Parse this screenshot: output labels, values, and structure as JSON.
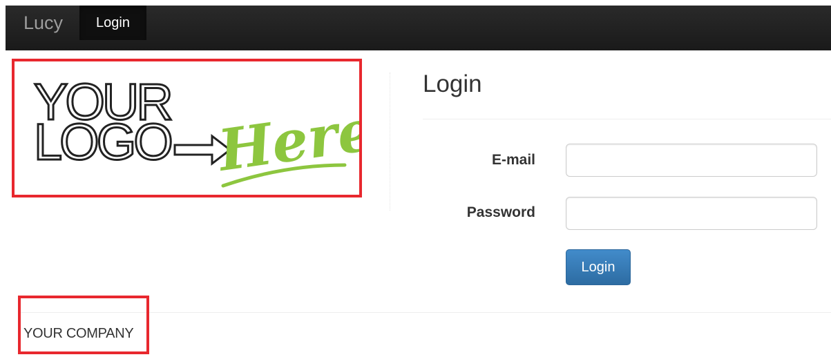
{
  "navbar": {
    "brand": "Lucy",
    "active_item": "Login"
  },
  "logo": {
    "line1": "YOUR",
    "line2": "LOGO",
    "script": "Here",
    "script_color": "#8dc63f",
    "frame_color": "#e8282e"
  },
  "login_form": {
    "title": "Login",
    "email_label": "E-mail",
    "email_value": "",
    "password_label": "Password",
    "password_value": "",
    "submit_label": "Login",
    "button_color": "#428bca"
  },
  "footer": {
    "company": "YOUR COMPANY"
  }
}
